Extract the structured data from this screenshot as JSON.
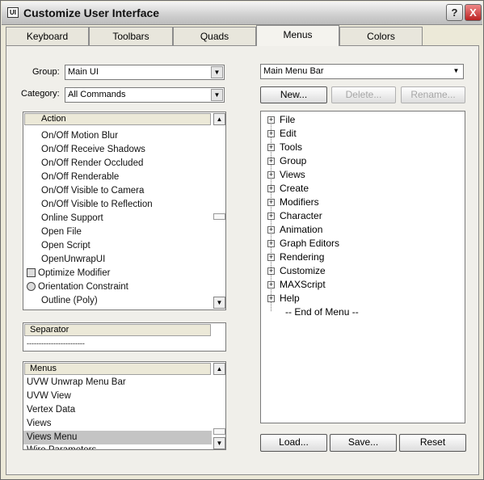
{
  "window": {
    "title": "Customize User Interface",
    "help_glyph": "?",
    "close_glyph": "X"
  },
  "tabs": [
    {
      "label": "Keyboard"
    },
    {
      "label": "Toolbars"
    },
    {
      "label": "Quads"
    },
    {
      "label": "Menus",
      "active": true
    },
    {
      "label": "Colors"
    }
  ],
  "left": {
    "group_label": "Group:",
    "group_value": "Main UI",
    "category_label": "Category:",
    "category_value": "All Commands",
    "actions": {
      "header": "Action",
      "items": [
        "On/Off Motion Blur",
        "On/Off Receive Shadows",
        "On/Off Render Occluded",
        "On/Off Renderable",
        "On/Off Visible to Camera",
        "On/Off Visible to Reflection",
        "Online Support",
        "Open File",
        "Open Script",
        "OpenUnwrapUI",
        "Optimize Modifier",
        "Orientation Constraint",
        "Outline (Poly)"
      ]
    },
    "separator": {
      "header": "Separator",
      "item": "------------------------"
    },
    "menus": {
      "header": "Menus",
      "items": [
        "UVW Unwrap Menu Bar",
        "UVW View",
        "Vertex Data",
        "Views",
        "Views Menu",
        "Wire Parameters"
      ],
      "selected_index": 4
    }
  },
  "right": {
    "menu_select_value": "Main Menu Bar",
    "new_label": "New...",
    "delete_label": "Delete...",
    "rename_label": "Rename...",
    "tree": [
      "File",
      "Edit",
      "Tools",
      "Group",
      "Views",
      "Create",
      "Modifiers",
      "Character",
      "Animation",
      "Graph Editors",
      "Rendering",
      "Customize",
      "MAXScript",
      "Help"
    ],
    "end_marker": "-- End of Menu --",
    "load_label": "Load...",
    "save_label": "Save...",
    "reset_label": "Reset"
  },
  "icons": {
    "combo_arrow": "▼",
    "scroll_up": "▲",
    "scroll_down": "▼",
    "tree_expand": "+",
    "app_icon_glyph": "UI"
  },
  "colors": {
    "window_bg": "#ece9d8",
    "selection": "#c4c4c4",
    "close_button": "#b22222"
  }
}
